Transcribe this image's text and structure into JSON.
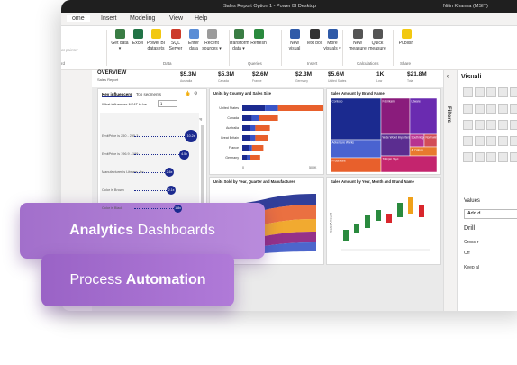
{
  "window": {
    "title": "Sales Report Option 1 - Power BI Desktop",
    "user": "Nitin Khanna (MSIT)"
  },
  "menu": [
    "ome",
    "Insert",
    "Modeling",
    "View",
    "Help"
  ],
  "ribbon": {
    "buttons": [
      {
        "label": "Get data ▾",
        "icon": "database-icon",
        "color": "#3a7d44"
      },
      {
        "label": "Excel",
        "icon": "excel-icon",
        "color": "#217346"
      },
      {
        "label": "Power BI datasets",
        "icon": "powerbi-datasets-icon",
        "color": "#f2c811"
      },
      {
        "label": "SQL Server",
        "icon": "sql-server-icon",
        "color": "#cc3b2b"
      },
      {
        "label": "Enter data",
        "icon": "table-icon",
        "color": "#5a8dd6"
      },
      {
        "label": "Recent sources ▾",
        "icon": "recent-sources-icon",
        "color": "#9b9b9b"
      },
      {
        "label": "Transform data ▾",
        "icon": "transform-icon",
        "color": "#3a7d44"
      },
      {
        "label": "Refresh",
        "icon": "refresh-icon",
        "color": "#2a8a3e"
      },
      {
        "label": "New visual",
        "icon": "new-visual-icon",
        "color": "#2f5aa8"
      },
      {
        "label": "Text box",
        "icon": "text-box-icon",
        "color": "#333333"
      },
      {
        "label": "More visuals ▾",
        "icon": "more-visuals-icon",
        "color": "#2f5aa8"
      },
      {
        "label": "New measure",
        "icon": "calculator-icon",
        "color": "#555555"
      },
      {
        "label": "Quick measure",
        "icon": "quick-measure-icon",
        "color": "#555555"
      },
      {
        "label": "Publish",
        "icon": "publish-icon",
        "color": "#f2c811"
      }
    ],
    "groups": [
      "Data",
      "Queries",
      "Insert",
      "Calculations",
      "Share"
    ],
    "left_fragments": [
      "at painter",
      "rd"
    ]
  },
  "report": {
    "overview_title": "OVERVIEW",
    "overview_sub": "Sales Report",
    "kpis": [
      "$5.3M",
      "$5.3M",
      "$2.6M",
      "$2.3M",
      "$5.6M",
      "1K",
      "$21.8M"
    ],
    "kpi_subs": [
      "Australia",
      "Canada",
      "France",
      "Germany",
      "United States",
      "Low",
      "Total"
    ]
  },
  "key_influencers": {
    "tab1": "Key influencers",
    "tab2": "Top segments",
    "question": "What influences NSAT to be",
    "value": "1",
    "header_when": "When...",
    "header_likely": "...the likelihood of NSAT being 1 increases by",
    "items": [
      {
        "label": "EmitPrice is 250 - 295.3",
        "value": "10.2x"
      },
      {
        "label": "EmitPrice is 196.9 - 199",
        "value": "4.5x"
      },
      {
        "label": "Manufacturer is Litware, Inc.",
        "value": "2.6x"
      },
      {
        "label": "Color is Brown",
        "value": "2.1x"
      },
      {
        "label": "Color is Black",
        "value": "1.8x"
      }
    ]
  },
  "panels": {
    "country": "Units by Country and Sales Size",
    "brand": "Sales Amount by Brand Name",
    "sankey": "Units Sold by Year, Quarter and Manufacturer",
    "waterfall": "Sales Amount by Year, Month and Brand Name"
  },
  "country_chart": {
    "categories": [
      "United States",
      "Canada",
      "Australia",
      "Great Britain",
      "France",
      "Germany"
    ],
    "axis": [
      "0",
      "500K"
    ],
    "colors": [
      "#1b2a8f",
      "#e8602c",
      "#3a55c7"
    ]
  },
  "brand_chart": {
    "labels": [
      "Contoso",
      "Adventure Works",
      "Proseware",
      "Fabrikam",
      "Wide World Importers",
      "Litware",
      "Southridge Video",
      "Northwind",
      "A. Datum",
      "Tailspin Toys"
    ],
    "colors": [
      "#1b2a8f",
      "#4a63d0",
      "#e8602c",
      "#8a1c7c",
      "#5b2d90",
      "#6a2bb0",
      "#b83290",
      "#d24d57",
      "#e87a2e",
      "#c4256e"
    ]
  },
  "waterfall": {
    "ylabel": "SalesAmount"
  },
  "sidebar": {
    "filters": "Filters",
    "visualizations": "Visuali",
    "values": "Values",
    "add": "Add d",
    "drill": "Drill",
    "cross": "Cross-r",
    "off": "Off",
    "keep": "Keep al"
  },
  "cards": {
    "card1_bold": "Analytics",
    "card1_rest": " Dashboards",
    "card2_rest": "Process ",
    "card2_bold": "Automation"
  }
}
